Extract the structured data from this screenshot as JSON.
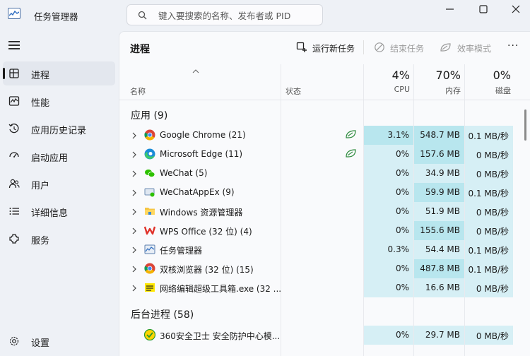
{
  "app": {
    "title": "任务管理器"
  },
  "search": {
    "placeholder": "键入要搜索的名称、发布者或 PID"
  },
  "sidebar": {
    "items": [
      {
        "label": "进程",
        "icon": "processes-icon",
        "active": true
      },
      {
        "label": "性能",
        "icon": "performance-icon"
      },
      {
        "label": "应用历史记录",
        "icon": "history-icon"
      },
      {
        "label": "启动应用",
        "icon": "startup-icon"
      },
      {
        "label": "用户",
        "icon": "users-icon"
      },
      {
        "label": "详细信息",
        "icon": "details-icon"
      },
      {
        "label": "服务",
        "icon": "services-icon"
      }
    ],
    "settings_label": "设置"
  },
  "main": {
    "title": "进程",
    "toolbar": {
      "run_task": "运行新任务",
      "end_task": "结束任务",
      "efficiency": "效率模式"
    },
    "columns": {
      "name": "名称",
      "status": "状态",
      "cpu_pct": "4%",
      "cpu": "CPU",
      "mem_pct": "70%",
      "mem": "内存",
      "disk_pct": "0%",
      "disk": "磁盘"
    },
    "apps_group": "应用 (9)",
    "bg_group": "后台进程 (58)",
    "apps": [
      {
        "name": "Google Chrome (21)",
        "cpu": "3.1%",
        "mem": "548.7 MB",
        "disk": "0.1 MB/秒",
        "eco": true
      },
      {
        "name": "Microsoft Edge (11)",
        "cpu": "0%",
        "mem": "157.6 MB",
        "disk": "0 MB/秒",
        "eco": true
      },
      {
        "name": "WeChat (5)",
        "cpu": "0%",
        "mem": "34.9 MB",
        "disk": "0 MB/秒"
      },
      {
        "name": "WeChatAppEx (9)",
        "cpu": "0%",
        "mem": "59.9 MB",
        "disk": "0.1 MB/秒"
      },
      {
        "name": "Windows 资源管理器",
        "cpu": "0%",
        "mem": "51.9 MB",
        "disk": "0 MB/秒"
      },
      {
        "name": "WPS Office (32 位) (4)",
        "cpu": "0%",
        "mem": "155.6 MB",
        "disk": "0 MB/秒"
      },
      {
        "name": "任务管理器",
        "cpu": "0.3%",
        "mem": "54.4 MB",
        "disk": "0.1 MB/秒"
      },
      {
        "name": "双核浏览器 (32 位) (15)",
        "cpu": "0%",
        "mem": "487.8 MB",
        "disk": "0.1 MB/秒"
      },
      {
        "name": "网络编辑超级工具箱.exe (32 ...",
        "cpu": "0%",
        "mem": "16.6 MB",
        "disk": "0 MB/秒"
      }
    ],
    "background": [
      {
        "name": "360安全卫士 安全防护中心模...",
        "cpu": "0%",
        "mem": "29.7 MB",
        "disk": "0 MB/秒"
      }
    ]
  }
}
